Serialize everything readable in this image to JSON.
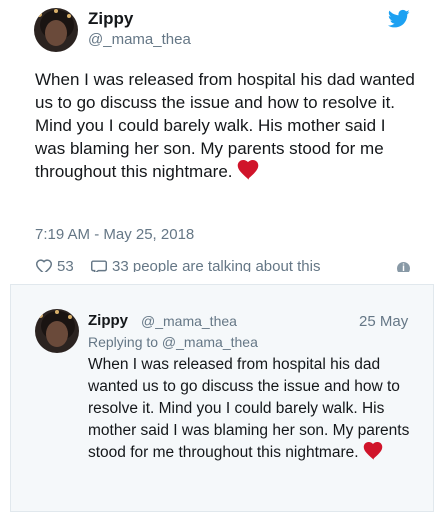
{
  "tweet": {
    "display_name": "Zippy",
    "handle": "@_mama_thea",
    "text": "When I was released from hospital his dad wanted us to go discuss the issue and how to resolve it. Mind you I could barely walk. His mother said I was blaming her son. My parents stood for me throughout this nightmare.",
    "emoji": "red-heart",
    "timestamp": "7:19 AM - May 25, 2018",
    "likes": "53",
    "talking": "33 people are talking about this"
  },
  "reply": {
    "display_name": "Zippy",
    "handle": "@_mama_thea",
    "date": "25 May",
    "replying_to": "Replying to @_mama_thea",
    "text": "When I was released from hospital his dad wanted us to go discuss the issue and how to resolve it. Mind you I could barely walk. His mother said I was blaming her son. My parents stood for me throughout this nightmare.",
    "emoji": "red-heart"
  },
  "colors": {
    "twitter_blue": "#1da1f2",
    "heart_red": "#d0142a",
    "muted_text": "#657786",
    "reply_bg": "#f5f8fa"
  },
  "icons": [
    "twitter-bird-icon",
    "heart-icon",
    "comment-icon",
    "info-icon"
  ]
}
